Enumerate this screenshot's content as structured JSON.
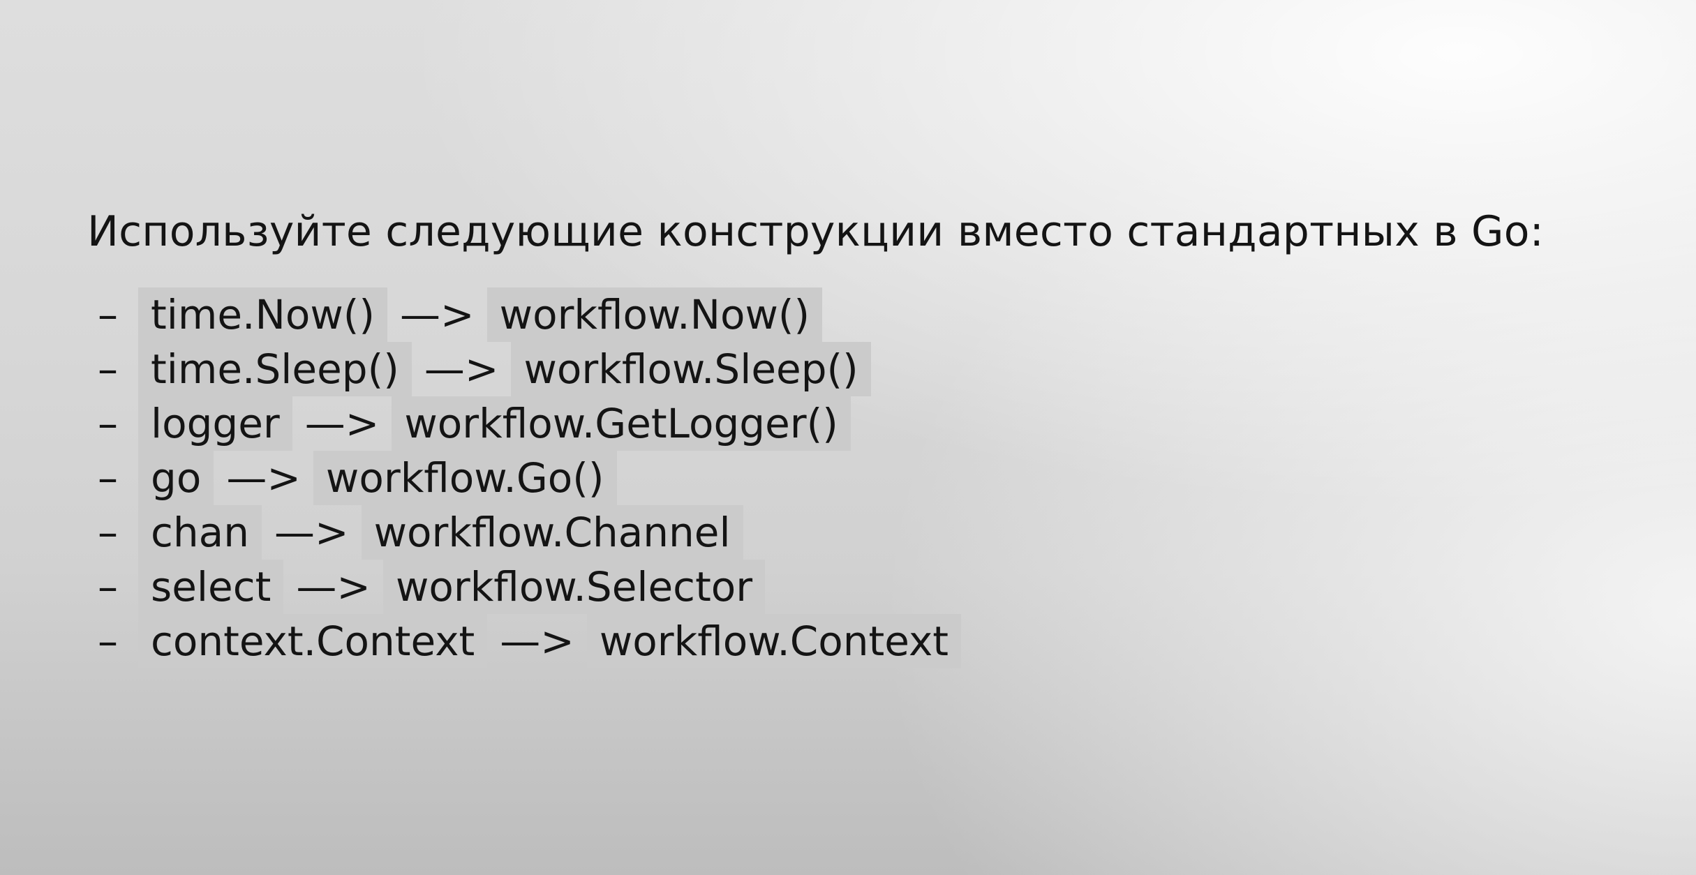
{
  "heading": "Используйте следующие конструкции вместо стандартных в Go:",
  "items": [
    {
      "dash": "–",
      "from": "time.Now()",
      "arrow": "—>",
      "to": "workflow.Now()"
    },
    {
      "dash": "–",
      "from": "time.Sleep()",
      "arrow": "—>",
      "to": "workflow.Sleep()"
    },
    {
      "dash": "–",
      "from": "logger",
      "arrow": "—>",
      "to": "workflow.GetLogger()"
    },
    {
      "dash": "–",
      "from": "go",
      "arrow": "—>",
      "to": "workflow.Go()"
    },
    {
      "dash": "–",
      "from": "chan",
      "arrow": "—>",
      "to": "workflow.Channel"
    },
    {
      "dash": "–",
      "from": "select",
      "arrow": "—>",
      "to": "workflow.Selector"
    },
    {
      "dash": "–",
      "from": "context.Context",
      "arrow": "—>",
      "to": "workflow.Context"
    }
  ],
  "colors": {
    "text": "#141414",
    "code_highlight": "#cbcbcb"
  }
}
